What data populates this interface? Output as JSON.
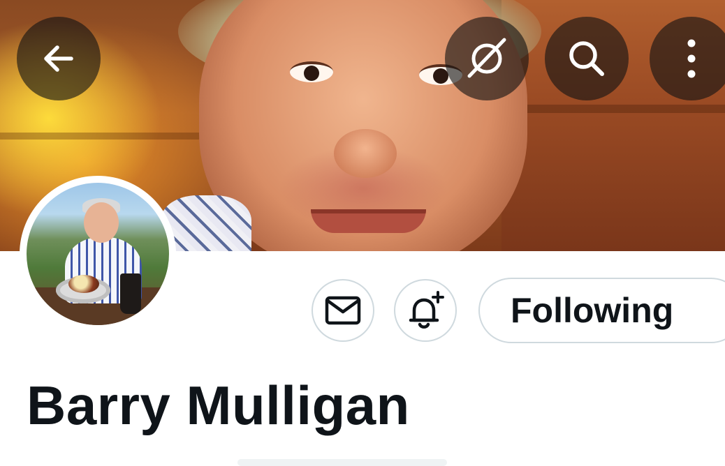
{
  "header": {
    "back_icon": "arrow-left-icon",
    "grok_icon": "grok-slash-icon",
    "search_icon": "search-icon",
    "more_icon": "more-vertical-icon"
  },
  "profile": {
    "display_name": "Barry Mulligan"
  },
  "actions": {
    "message_icon": "mail-icon",
    "notify_icon": "bell-plus-icon",
    "follow_label": "Following"
  },
  "colors": {
    "text": "#0f1419",
    "border": "#cfd9de",
    "overlay_button": "#141414"
  }
}
